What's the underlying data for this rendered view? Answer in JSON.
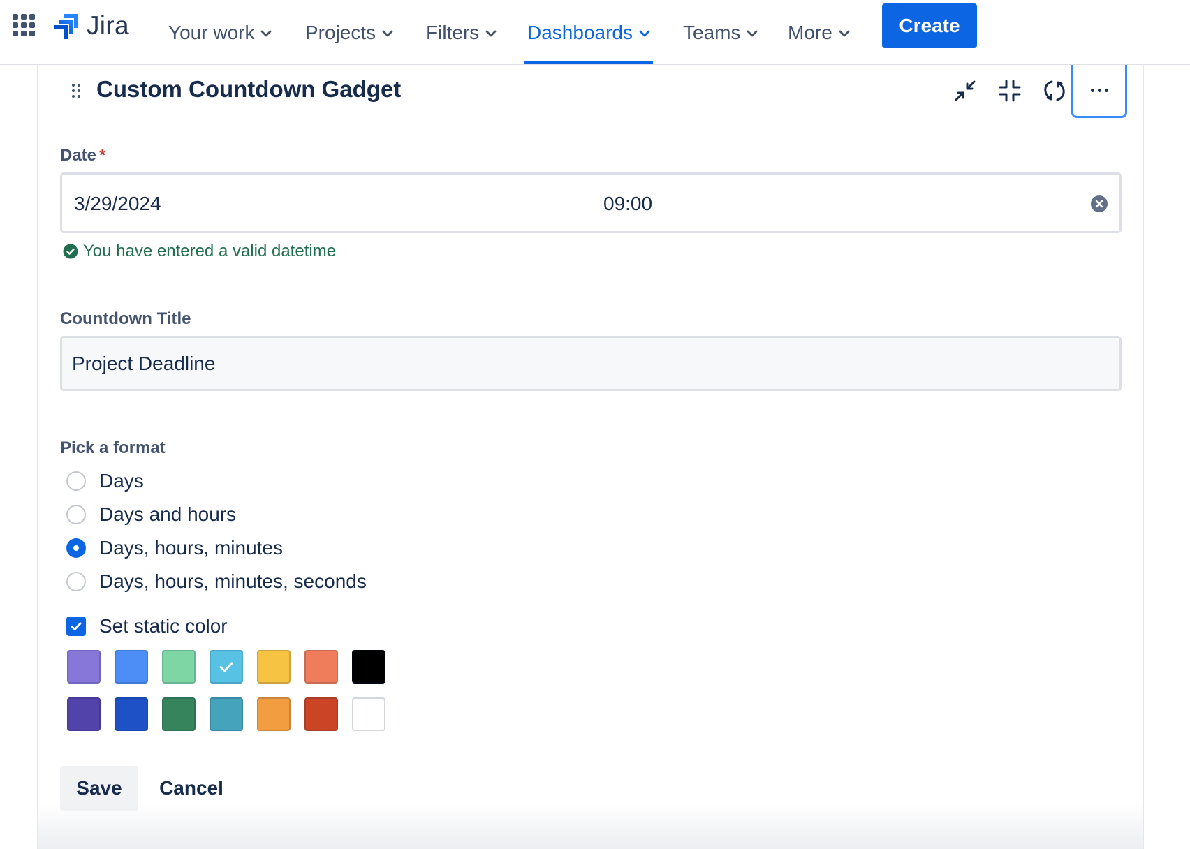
{
  "nav": {
    "app_switcher_icon": "grid-icon",
    "logo_text": "Jira",
    "items": [
      {
        "label": "Your work",
        "active": false
      },
      {
        "label": "Projects",
        "active": false
      },
      {
        "label": "Filters",
        "active": false
      },
      {
        "label": "Dashboards",
        "active": true
      },
      {
        "label": "Teams",
        "active": false
      },
      {
        "label": "More",
        "active": false
      }
    ],
    "create_label": "Create"
  },
  "gadget": {
    "title": "Custom Countdown Gadget",
    "header_icons": [
      "minimize-icon",
      "collapse-icon",
      "refresh-icon",
      "more-icon"
    ]
  },
  "form": {
    "date_label": "Date",
    "required_mark": "*",
    "date_value": "3/29/2024",
    "time_value": "09:00",
    "valid_message": "You have entered a valid datetime",
    "countdown_title_label": "Countdown Title",
    "countdown_title_value": "Project Deadline",
    "format_label": "Pick a format",
    "formats": [
      {
        "label": "Days",
        "checked": false
      },
      {
        "label": "Days and hours",
        "checked": false
      },
      {
        "label": "Days, hours, minutes",
        "checked": true
      },
      {
        "label": "Days, hours, minutes, seconds",
        "checked": false
      }
    ],
    "static_color_label": "Set static color",
    "static_color_checked": true,
    "colors": [
      [
        "#8777d9",
        "#4c8df6",
        "#7ed6a5",
        "#57c2e3",
        "#f6c342",
        "#ef7d5b",
        "#000000"
      ],
      [
        "#5243aa",
        "#1f51c6",
        "#36845c",
        "#45a3bc",
        "#f29d3f",
        "#cc4426",
        "#ffffff"
      ]
    ],
    "selected_color": "#57c2e3",
    "save_label": "Save",
    "cancel_label": "Cancel"
  },
  "colors": {
    "accent": "#0c66e4",
    "success": "#216e4e",
    "required": "#c9372c",
    "focus_ring": "#388bff"
  }
}
